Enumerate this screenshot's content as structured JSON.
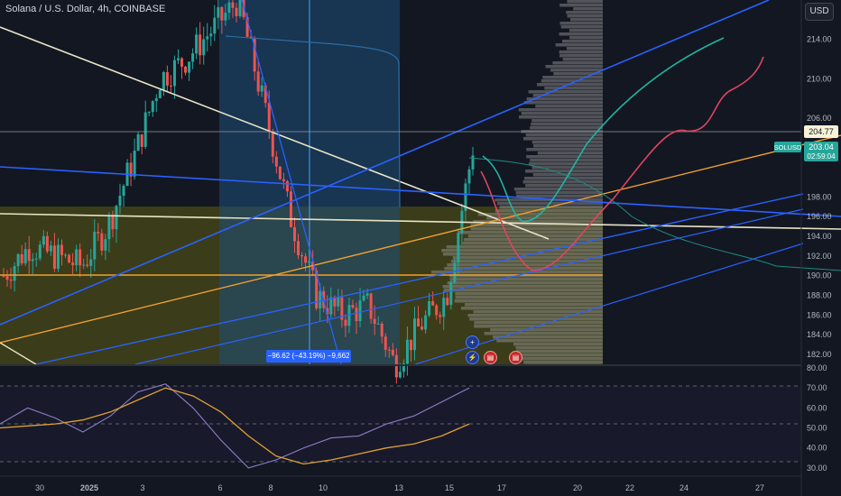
{
  "header": {
    "title": "Solana / U.S. Dollar, 4h, COINBASE",
    "currency": "USD"
  },
  "last_price": {
    "value": 204.77,
    "label": "204.77"
  },
  "symbol_tag": {
    "ticker": "SOLUSD",
    "price": "203.04",
    "countdown": "02:59:04"
  },
  "measure_label": "−96.62 (−43.19%) −9,662",
  "events": [
    {
      "name": "plus-icon",
      "glyph": "+"
    },
    {
      "name": "lightning-icon",
      "glyph": "⚡"
    },
    {
      "name": "us-flag-icon",
      "glyph": "▤"
    },
    {
      "name": "us-flag-icon",
      "glyph": "▤"
    }
  ],
  "colors": {
    "background": "#131722",
    "up": "#26a69a",
    "down": "#ef5350",
    "blue_line": "#2962ff",
    "white_line": "#e8e3c5",
    "orange_line": "#f0a030",
    "teal_path": "#1fb5a0",
    "red_path": "#e04460",
    "rsi_line": "#8c7fc7",
    "rsi_ma": "#e0a030",
    "zone_olive": "#4a4a18",
    "zone_blue": "#1d4f7a",
    "volume_profile": "#9e9e9e"
  },
  "chart_data": [
    {
      "type": "line",
      "title": "Solana / U.S. Dollar, 4h, COINBASE",
      "y_ticks": [
        "214.00",
        "210.00",
        "206.00",
        "202.00",
        "198.00",
        "196.00",
        "194.00",
        "192.00",
        "190.00",
        "188.00",
        "186.00",
        "184.00",
        "182.00"
      ],
      "x_ticks": [
        "30",
        "2025",
        "3",
        "6",
        "8",
        "10",
        "13",
        "15",
        "17",
        "20",
        "22",
        "24",
        "27"
      ],
      "ylim": [
        181,
        218
      ],
      "close_path": {
        "x": [
          "29",
          "30",
          "31",
          "2025-01-01",
          "2",
          "3",
          "4",
          "5",
          "6",
          "7",
          "8",
          "9",
          "10",
          "11",
          "12",
          "13",
          "14",
          "15",
          "16"
        ],
        "y": [
          190,
          193,
          192,
          191,
          195,
          202,
          210,
          212,
          215,
          218,
          207,
          196,
          188,
          186,
          187,
          181,
          185,
          188,
          203
        ]
      },
      "horizontal_levels": [
        {
          "name": "last-price",
          "value": 204.77
        },
        {
          "name": "orange-level",
          "value": 189.2
        }
      ]
    },
    {
      "type": "line",
      "title": "RSI",
      "y_ticks": [
        "80.00",
        "70.00",
        "60.00",
        "50.00",
        "40.00",
        "30.00"
      ],
      "ylim": [
        25,
        80
      ],
      "rsi": [
        52,
        60,
        55,
        48,
        56,
        68,
        72,
        60,
        44,
        30,
        34,
        40,
        45,
        46,
        52,
        56,
        63,
        70
      ],
      "rsi_ma": [
        50,
        51,
        52,
        54,
        58,
        64,
        70,
        66,
        58,
        46,
        36,
        32,
        34,
        37,
        40,
        42,
        46,
        52
      ]
    }
  ]
}
